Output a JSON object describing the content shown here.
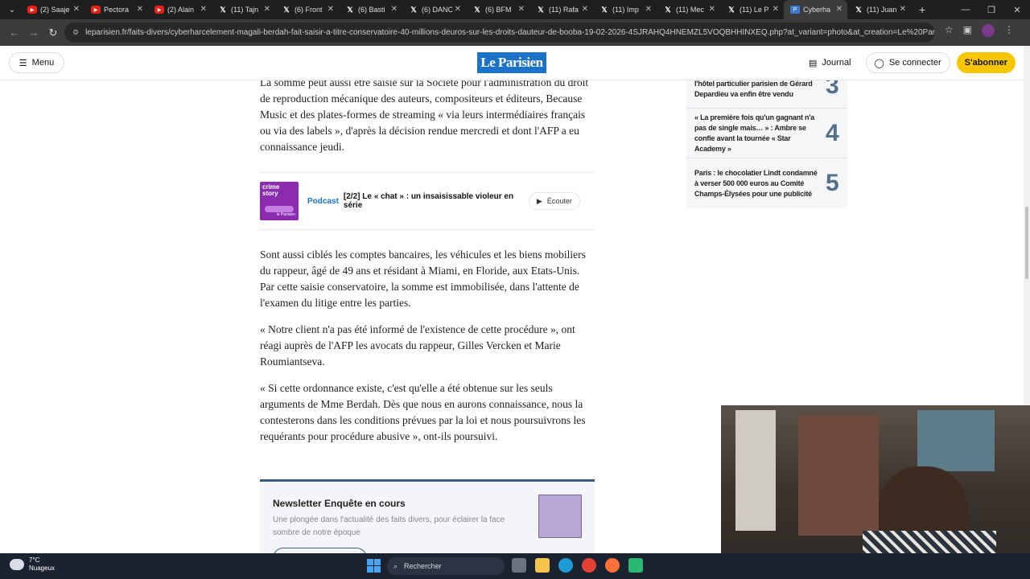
{
  "browser": {
    "tabs": [
      {
        "label": "(2) Saaje",
        "icon": "youtube-icon"
      },
      {
        "label": "Pectora",
        "icon": "youtube-icon"
      },
      {
        "label": "(2) Alain",
        "icon": "youtube-icon"
      },
      {
        "label": "(11) Tajn",
        "icon": "x-icon"
      },
      {
        "label": "(6) Front",
        "icon": "x-icon"
      },
      {
        "label": "(6) Basti",
        "icon": "x-icon"
      },
      {
        "label": "(6) DANC",
        "icon": "x-icon"
      },
      {
        "label": "(6) BFM",
        "icon": "x-icon"
      },
      {
        "label": "(11) Rafa",
        "icon": "x-icon"
      },
      {
        "label": "(11) Imp",
        "icon": "x-icon"
      },
      {
        "label": "(11) Mec",
        "icon": "x-icon"
      },
      {
        "label": "(11) Le P",
        "icon": "x-icon"
      },
      {
        "label": "Cyberha",
        "icon": "leparisien-icon",
        "active": true
      },
      {
        "label": "(11) Juan",
        "icon": "x-icon"
      }
    ],
    "url": "leparisien.fr/faits-divers/cyberharcelement-magali-berdah-fait-saisir-a-titre-conservatoire-40-millions-deuros-sur-les-droits-dauteur-de-booba-19-02-2026-4SJRAHQ4HNEMZL5VOQBHHINXEQ.php?at_variant=photo&at_creation=Le%20Parisien&at_camp..."
  },
  "site": {
    "menu_label": "Menu",
    "logo": "Le Parisien",
    "journal_label": "Journal",
    "login_label": "Se connecter",
    "subscribe_label": "S'abonner"
  },
  "article": {
    "para1": "La somme peut aussi être saisie sur la Société pour l'administration du droit de reproduction mécanique des auteurs, compositeurs et éditeurs, Because Music et des plates-formes de streaming « via leurs intermédiaires français ou via des labels », d'après la décision rendue mercredi et dont l'AFP a eu connaissance jeudi.",
    "podcast": {
      "cover_title": "crime story",
      "cover_brand": "le Parisien",
      "tag": "Podcast",
      "title": "[2/2] Le « chat » : un insaisissable violeur en série",
      "listen_label": "Écouter"
    },
    "para2": "Sont aussi ciblés les comptes bancaires, les véhicules et les biens mobiliers du rappeur, âgé de 49 ans et résidant à Miami, en Floride, aux Etats-Unis. Par cette saisie conservatoire, la somme est immobilisée, dans l'attente de l'examen du litige entre les parties.",
    "para3": "« Notre client n'a pas été informé de l'existence de cette procédure », ont réagi auprès de l'AFP les avocats du rappeur, Gilles Vercken et Marie Roumiantseva.",
    "para4": "« Si cette ordonnance existe, c'est qu'elle a été obtenue sur les seuls arguments de Mme Berdah. Dès que nous en aurons connaissance, nous la contesterons dans les conditions prévues par la loi et nous poursuivrons les requérants pour procédure abusive », ont-ils poursuivi.",
    "newsletter": {
      "title": "Newsletter Enquête en cours",
      "desc": "Une plongée dans l'actualité des faits divers, pour éclairer la face sombre de notre époque"
    }
  },
  "trending": [
    {
      "text": "l'hôtel particulier parisien de Gérard Depardieu va enfin être vendu",
      "num": "3"
    },
    {
      "text": "« La première fois qu'un gagnant n'a pas de single mais… » : Ambre se confie avant la tournée « Star Academy »",
      "num": "4"
    },
    {
      "text": "Paris : le chocolatier Lindt condamné à verser 500 000 euros au Comité Champs-Élysées pour une publicité",
      "num": "5"
    }
  ],
  "taskbar": {
    "temp": "7°C",
    "weather": "Nuageux",
    "search_label": "Rechercher"
  }
}
